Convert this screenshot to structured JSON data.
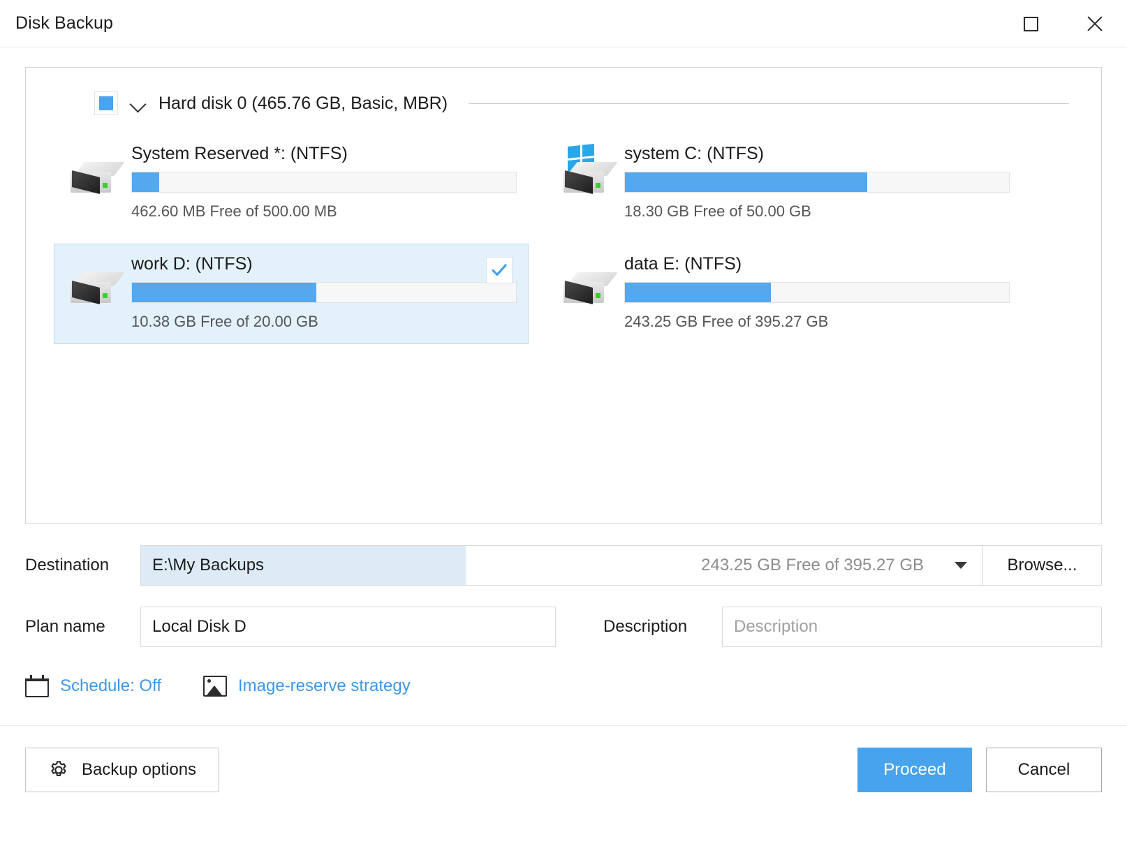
{
  "window": {
    "title": "Disk Backup",
    "maximize_icon": "maximize-icon",
    "close_icon": "close-icon"
  },
  "disk": {
    "checkbox_state": "indeterminate",
    "expander_icon": "chevron-down-icon",
    "label": "Hard disk 0 (465.76 GB, Basic, MBR)",
    "partitions": [
      {
        "name": "System Reserved *: (NTFS)",
        "space": "462.60 MB Free of 500.00 MB",
        "used_percent": 7,
        "selected": false,
        "checked": false,
        "icon": "drive-icon"
      },
      {
        "name": "system C: (NTFS)",
        "space": "18.30 GB Free of 50.00 GB",
        "used_percent": 63,
        "selected": false,
        "checked": false,
        "icon": "windows-drive-icon"
      },
      {
        "name": "work D: (NTFS)",
        "space": "10.38 GB Free of 20.00 GB",
        "used_percent": 48,
        "selected": true,
        "checked": true,
        "icon": "drive-icon"
      },
      {
        "name": "data E: (NTFS)",
        "space": "243.25 GB Free of 395.27 GB",
        "used_percent": 38,
        "selected": false,
        "checked": false,
        "icon": "drive-icon"
      }
    ]
  },
  "destination": {
    "label": "Destination",
    "value": "E:\\My Backups",
    "free_space": "243.25 GB Free of 395.27 GB",
    "dropdown_icon": "chevron-down-icon",
    "browse_label": "Browse..."
  },
  "plan": {
    "name_label": "Plan name",
    "name_value": "Local Disk D",
    "description_label": "Description",
    "description_placeholder": "Description",
    "description_value": ""
  },
  "links": [
    {
      "icon": "calendar-icon",
      "label": "Schedule: Off"
    },
    {
      "icon": "image-icon",
      "label": "Image-reserve strategy"
    }
  ],
  "footer": {
    "options_label": "Backup options",
    "options_icon": "gear-icon",
    "proceed_label": "Proceed",
    "cancel_label": "Cancel"
  },
  "colors": {
    "accent": "#47a3ec",
    "bar_used": "#55a7ee",
    "selection_bg": "#e3f1fb",
    "link": "#3e97ea"
  }
}
